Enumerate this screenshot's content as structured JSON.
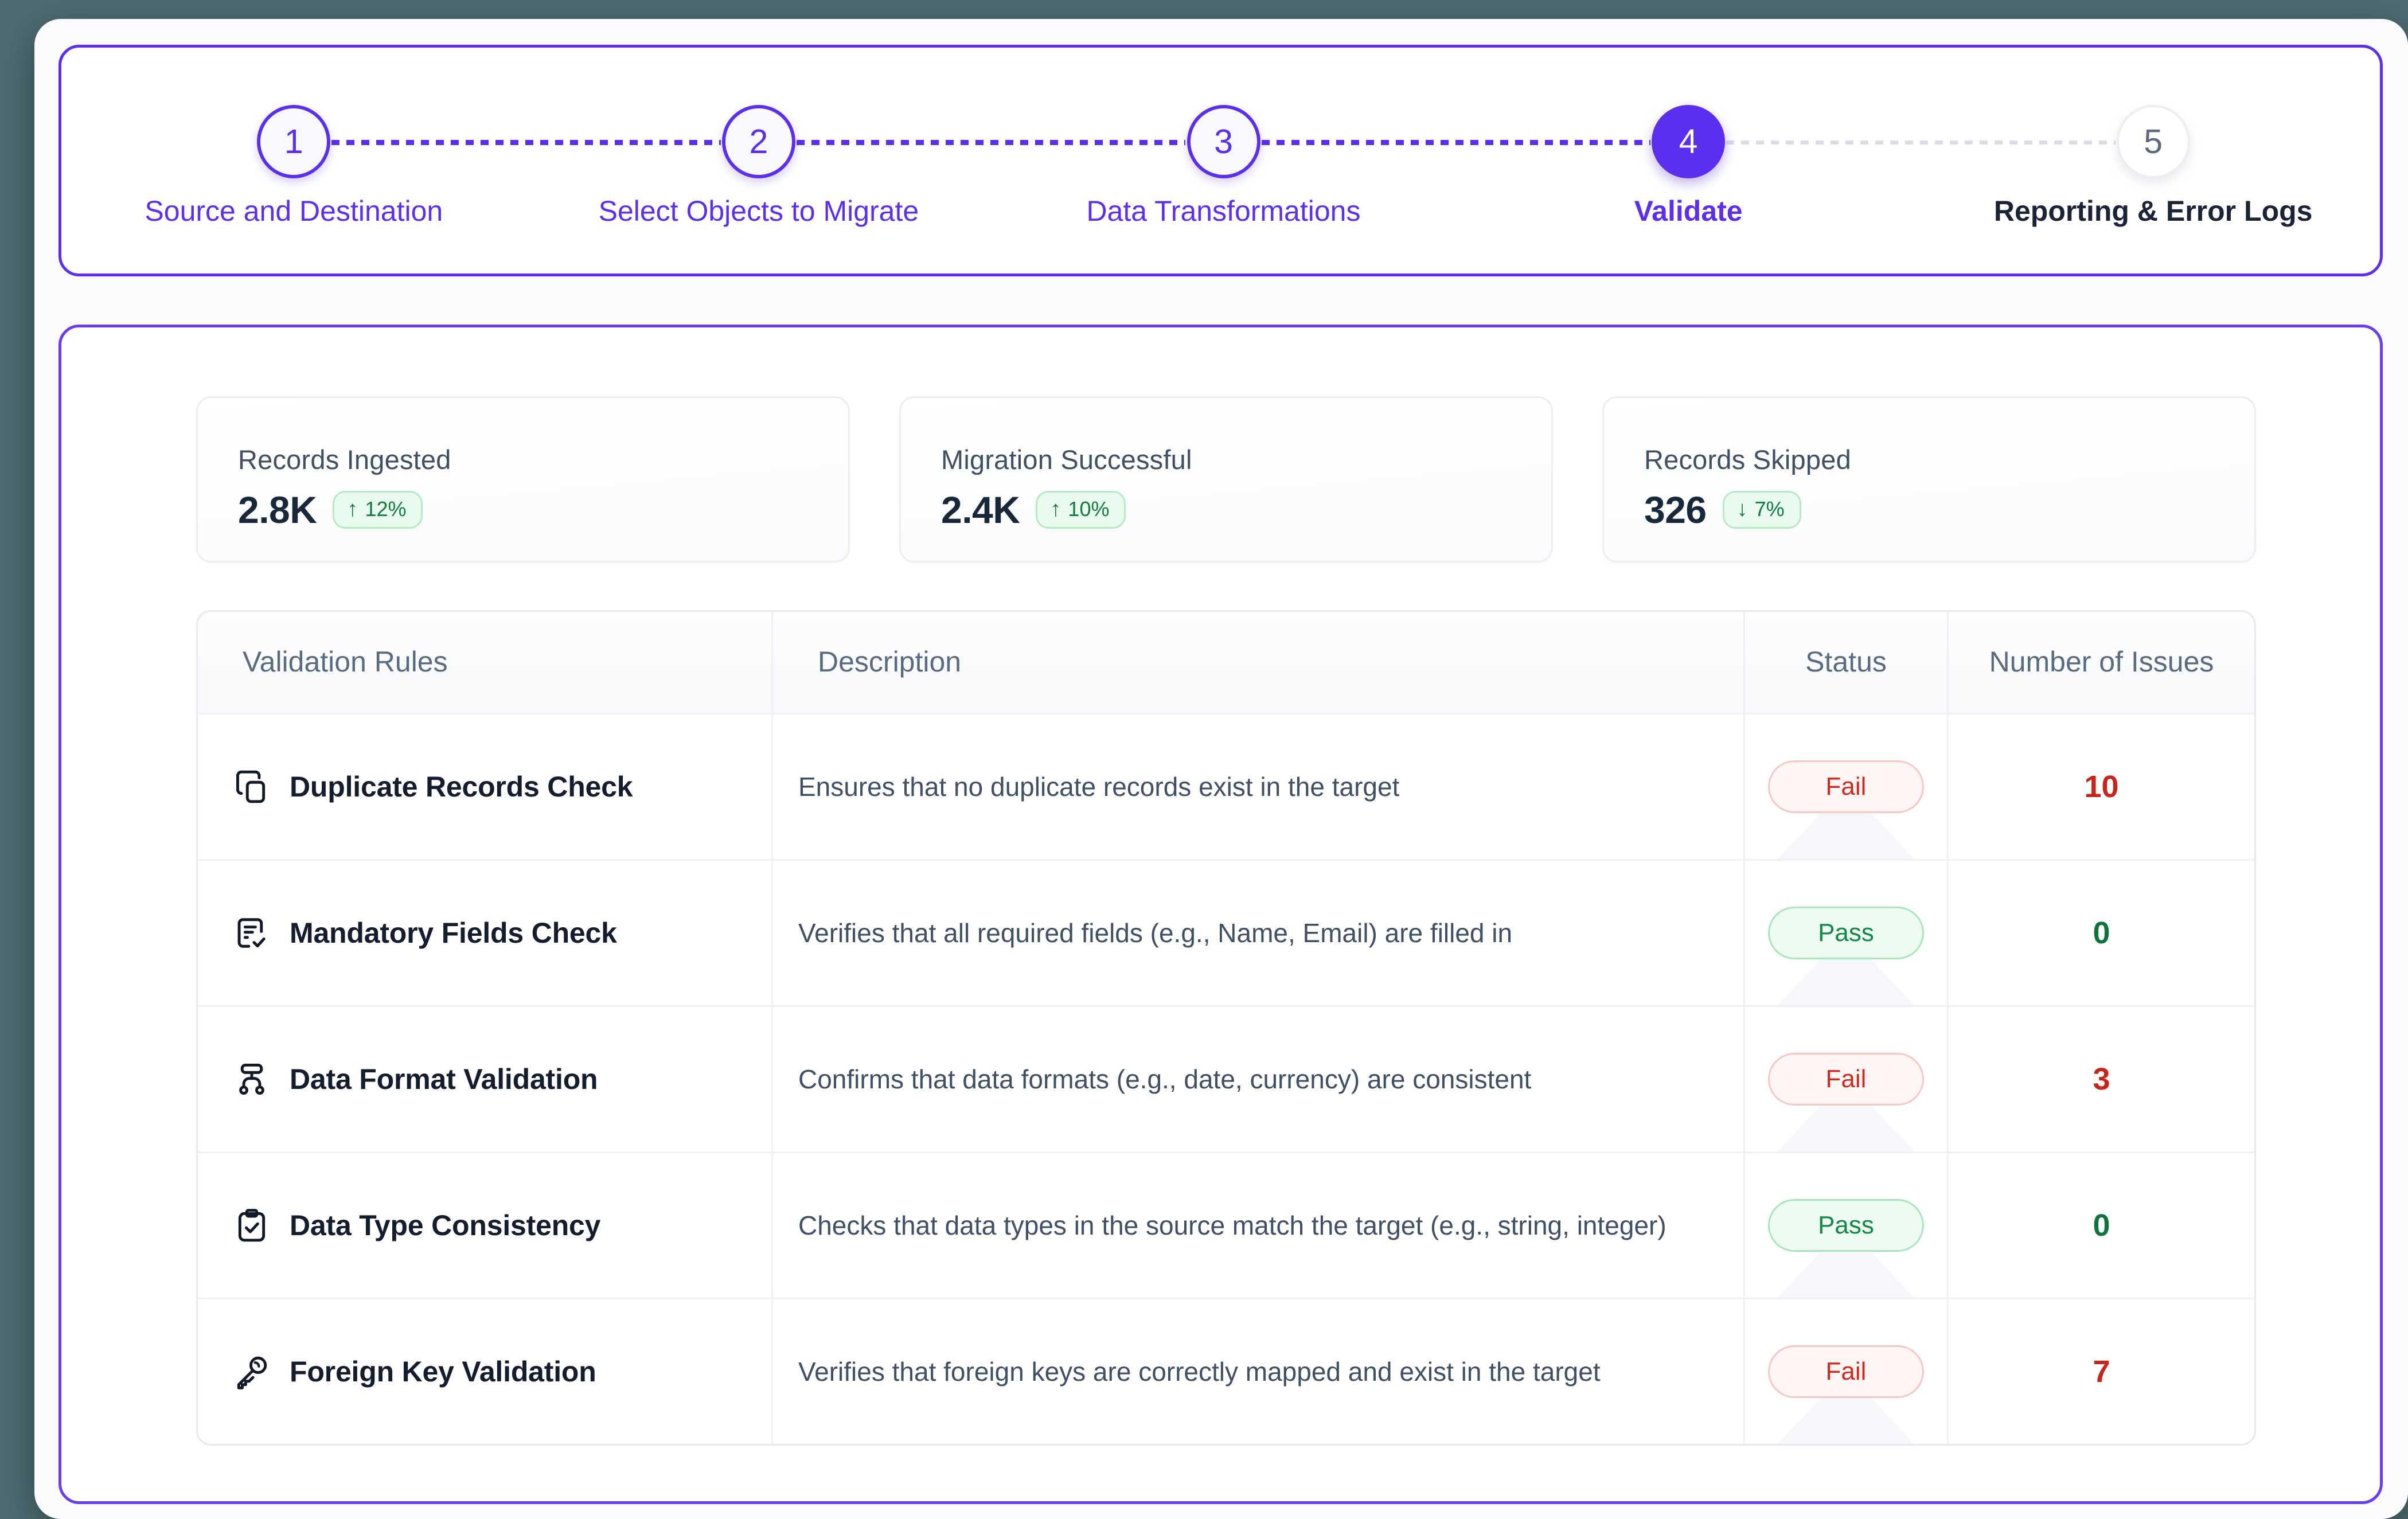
{
  "stepper": {
    "steps": [
      {
        "number": "1",
        "label": "Source and Destination",
        "state": "done"
      },
      {
        "number": "2",
        "label": "Select Objects to Migrate",
        "state": "done"
      },
      {
        "number": "3",
        "label": "Data Transformations",
        "state": "done"
      },
      {
        "number": "4",
        "label": "Validate",
        "state": "active"
      },
      {
        "number": "5",
        "label": "Reporting & Error Logs",
        "state": "todo"
      }
    ]
  },
  "stats": [
    {
      "label": "Records Ingested",
      "value": "2.8K",
      "delta": "12%",
      "direction": "up",
      "arrow": "↑"
    },
    {
      "label": "Migration Successful",
      "value": "2.4K",
      "delta": "10%",
      "direction": "up",
      "arrow": "↑"
    },
    {
      "label": "Records Skipped",
      "value": "326",
      "delta": "7%",
      "direction": "down",
      "arrow": "↓"
    }
  ],
  "table": {
    "headers": {
      "rule": "Validation Rules",
      "description": "Description",
      "status": "Status",
      "issues": "Number of Issues"
    },
    "rows": [
      {
        "icon": "copy-icon",
        "rule": "Duplicate Records Check",
        "description": "Ensures that no duplicate records exist in the target",
        "status": "Fail",
        "status_kind": "fail",
        "issues": "10",
        "issues_kind": "bad"
      },
      {
        "icon": "document-check-icon",
        "rule": "Mandatory Fields Check",
        "description": "Verifies that all required fields (e.g., Name, Email) are filled in",
        "status": "Pass",
        "status_kind": "pass",
        "issues": "0",
        "issues_kind": "good"
      },
      {
        "icon": "hierarchy-icon",
        "rule": "Data Format Validation",
        "description": "Confirms that data formats (e.g., date, currency) are consistent",
        "status": "Fail",
        "status_kind": "fail",
        "issues": "3",
        "issues_kind": "bad"
      },
      {
        "icon": "clipboard-check-icon",
        "rule": "Data Type Consistency",
        "description": "Checks that data types in the source match the target (e.g., string, integer)",
        "status": "Pass",
        "status_kind": "pass",
        "issues": "0",
        "issues_kind": "good"
      },
      {
        "icon": "key-icon",
        "rule": "Foreign Key Validation",
        "description": "Verifies that foreign keys are correctly mapped and exist in the target",
        "status": "Fail",
        "status_kind": "fail",
        "issues": "7",
        "issues_kind": "bad"
      }
    ]
  },
  "colors": {
    "accent": "#5b2ef0",
    "page_background": "#4d6b71",
    "surface": "#ffffff",
    "fail_text": "#cc2b20",
    "pass_text": "#15874a",
    "muted_text": "#5a6b80"
  }
}
